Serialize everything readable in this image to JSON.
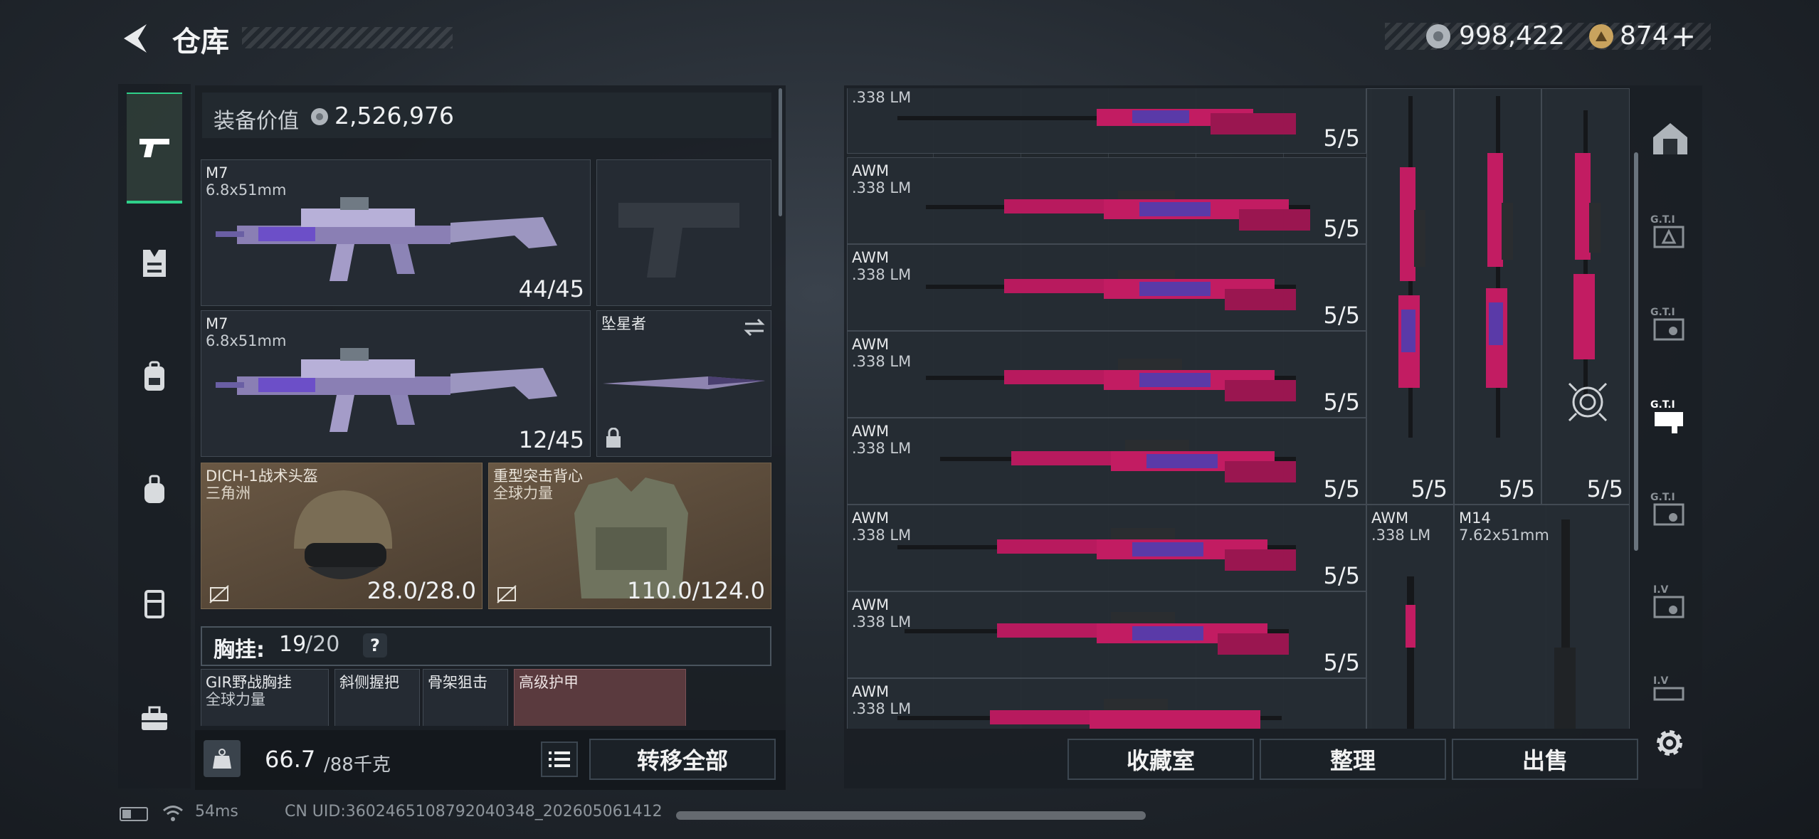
{
  "header": {
    "title": "仓库",
    "silver": "998,422",
    "gold": "874",
    "gold_add": "+"
  },
  "loadout": {
    "value_label": "装备价值",
    "value": "2,526,976",
    "primary1": {
      "name": "M7",
      "caliber": "6.8x51mm",
      "ammo": "44/45"
    },
    "primary2": {
      "name": "M7",
      "caliber": "6.8x51mm",
      "ammo": "12/45"
    },
    "melee": {
      "name": "坠星者"
    },
    "helmet": {
      "name": "DICH-1战术头盔",
      "brand": "三角洲",
      "durability": "28.0/28.0"
    },
    "armor": {
      "name": "重型突击背心",
      "brand": "全球力量",
      "durability": "110.0/124.0"
    },
    "chest_rig": {
      "label": "胸挂:",
      "used": "19",
      "total": "/20",
      "help": "?"
    },
    "rig_items": [
      {
        "name": "GIR野战胸挂",
        "brand": "全球力量"
      },
      {
        "name": "斜侧握把",
        "brand": ""
      },
      {
        "name": "骨架狙击",
        "brand": ""
      },
      {
        "name": "高级护甲",
        "brand": ""
      }
    ],
    "weight": {
      "current": "66.7",
      "max": "/88千克"
    },
    "transfer_all": "转移全部"
  },
  "storage": {
    "items": [
      {
        "name": "",
        "caliber": ".338 LM",
        "ammo": "5/5"
      },
      {
        "name": "AWM",
        "caliber": ".338 LM",
        "ammo": "5/5"
      },
      {
        "name": "AWM",
        "caliber": ".338 LM",
        "ammo": "5/5"
      },
      {
        "name": "AWM",
        "caliber": ".338 LM",
        "ammo": "5/5"
      },
      {
        "name": "AWM",
        "caliber": ".338 LM",
        "ammo": "5/5"
      },
      {
        "name": "AWM",
        "caliber": ".338 LM",
        "ammo": "5/5"
      },
      {
        "name": "AWM",
        "caliber": ".338 LM",
        "ammo": "5/5"
      },
      {
        "name": "AWM",
        "caliber": ".338 LM",
        "ammo": ""
      }
    ],
    "vertical_ammo": [
      "5/5",
      "5/5",
      "5/5"
    ],
    "small_items": [
      {
        "name": "AWM",
        "caliber": ".338 LM"
      },
      {
        "name": "M14",
        "caliber": "7.62x51mm"
      }
    ],
    "buttons": {
      "collection": "收藏室",
      "organize": "整理",
      "sell": "出售"
    }
  },
  "status": {
    "ping": "54ms",
    "uid": "CN UID:3602465108792040348_202605061412"
  },
  "colors": {
    "accent_green": "#2fd08a",
    "weapon_pink": "#e0206e",
    "weapon_purple": "#7a3ad0"
  }
}
